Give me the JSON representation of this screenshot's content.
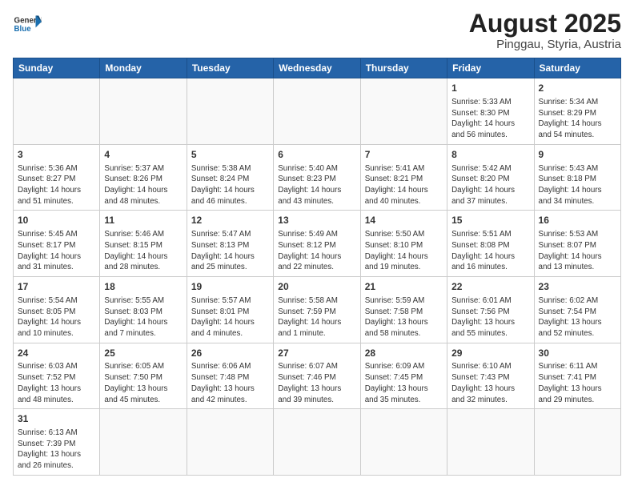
{
  "header": {
    "logo_general": "General",
    "logo_blue": "Blue",
    "title": "August 2025",
    "subtitle": "Pinggau, Styria, Austria"
  },
  "weekdays": [
    "Sunday",
    "Monday",
    "Tuesday",
    "Wednesday",
    "Thursday",
    "Friday",
    "Saturday"
  ],
  "weeks": [
    [
      {
        "day": "",
        "info": ""
      },
      {
        "day": "",
        "info": ""
      },
      {
        "day": "",
        "info": ""
      },
      {
        "day": "",
        "info": ""
      },
      {
        "day": "",
        "info": ""
      },
      {
        "day": "1",
        "info": "Sunrise: 5:33 AM\nSunset: 8:30 PM\nDaylight: 14 hours and 56 minutes."
      },
      {
        "day": "2",
        "info": "Sunrise: 5:34 AM\nSunset: 8:29 PM\nDaylight: 14 hours and 54 minutes."
      }
    ],
    [
      {
        "day": "3",
        "info": "Sunrise: 5:36 AM\nSunset: 8:27 PM\nDaylight: 14 hours and 51 minutes."
      },
      {
        "day": "4",
        "info": "Sunrise: 5:37 AM\nSunset: 8:26 PM\nDaylight: 14 hours and 48 minutes."
      },
      {
        "day": "5",
        "info": "Sunrise: 5:38 AM\nSunset: 8:24 PM\nDaylight: 14 hours and 46 minutes."
      },
      {
        "day": "6",
        "info": "Sunrise: 5:40 AM\nSunset: 8:23 PM\nDaylight: 14 hours and 43 minutes."
      },
      {
        "day": "7",
        "info": "Sunrise: 5:41 AM\nSunset: 8:21 PM\nDaylight: 14 hours and 40 minutes."
      },
      {
        "day": "8",
        "info": "Sunrise: 5:42 AM\nSunset: 8:20 PM\nDaylight: 14 hours and 37 minutes."
      },
      {
        "day": "9",
        "info": "Sunrise: 5:43 AM\nSunset: 8:18 PM\nDaylight: 14 hours and 34 minutes."
      }
    ],
    [
      {
        "day": "10",
        "info": "Sunrise: 5:45 AM\nSunset: 8:17 PM\nDaylight: 14 hours and 31 minutes."
      },
      {
        "day": "11",
        "info": "Sunrise: 5:46 AM\nSunset: 8:15 PM\nDaylight: 14 hours and 28 minutes."
      },
      {
        "day": "12",
        "info": "Sunrise: 5:47 AM\nSunset: 8:13 PM\nDaylight: 14 hours and 25 minutes."
      },
      {
        "day": "13",
        "info": "Sunrise: 5:49 AM\nSunset: 8:12 PM\nDaylight: 14 hours and 22 minutes."
      },
      {
        "day": "14",
        "info": "Sunrise: 5:50 AM\nSunset: 8:10 PM\nDaylight: 14 hours and 19 minutes."
      },
      {
        "day": "15",
        "info": "Sunrise: 5:51 AM\nSunset: 8:08 PM\nDaylight: 14 hours and 16 minutes."
      },
      {
        "day": "16",
        "info": "Sunrise: 5:53 AM\nSunset: 8:07 PM\nDaylight: 14 hours and 13 minutes."
      }
    ],
    [
      {
        "day": "17",
        "info": "Sunrise: 5:54 AM\nSunset: 8:05 PM\nDaylight: 14 hours and 10 minutes."
      },
      {
        "day": "18",
        "info": "Sunrise: 5:55 AM\nSunset: 8:03 PM\nDaylight: 14 hours and 7 minutes."
      },
      {
        "day": "19",
        "info": "Sunrise: 5:57 AM\nSunset: 8:01 PM\nDaylight: 14 hours and 4 minutes."
      },
      {
        "day": "20",
        "info": "Sunrise: 5:58 AM\nSunset: 7:59 PM\nDaylight: 14 hours and 1 minute."
      },
      {
        "day": "21",
        "info": "Sunrise: 5:59 AM\nSunset: 7:58 PM\nDaylight: 13 hours and 58 minutes."
      },
      {
        "day": "22",
        "info": "Sunrise: 6:01 AM\nSunset: 7:56 PM\nDaylight: 13 hours and 55 minutes."
      },
      {
        "day": "23",
        "info": "Sunrise: 6:02 AM\nSunset: 7:54 PM\nDaylight: 13 hours and 52 minutes."
      }
    ],
    [
      {
        "day": "24",
        "info": "Sunrise: 6:03 AM\nSunset: 7:52 PM\nDaylight: 13 hours and 48 minutes."
      },
      {
        "day": "25",
        "info": "Sunrise: 6:05 AM\nSunset: 7:50 PM\nDaylight: 13 hours and 45 minutes."
      },
      {
        "day": "26",
        "info": "Sunrise: 6:06 AM\nSunset: 7:48 PM\nDaylight: 13 hours and 42 minutes."
      },
      {
        "day": "27",
        "info": "Sunrise: 6:07 AM\nSunset: 7:46 PM\nDaylight: 13 hours and 39 minutes."
      },
      {
        "day": "28",
        "info": "Sunrise: 6:09 AM\nSunset: 7:45 PM\nDaylight: 13 hours and 35 minutes."
      },
      {
        "day": "29",
        "info": "Sunrise: 6:10 AM\nSunset: 7:43 PM\nDaylight: 13 hours and 32 minutes."
      },
      {
        "day": "30",
        "info": "Sunrise: 6:11 AM\nSunset: 7:41 PM\nDaylight: 13 hours and 29 minutes."
      }
    ],
    [
      {
        "day": "31",
        "info": "Sunrise: 6:13 AM\nSunset: 7:39 PM\nDaylight: 13 hours and 26 minutes."
      },
      {
        "day": "",
        "info": ""
      },
      {
        "day": "",
        "info": ""
      },
      {
        "day": "",
        "info": ""
      },
      {
        "day": "",
        "info": ""
      },
      {
        "day": "",
        "info": ""
      },
      {
        "day": "",
        "info": ""
      }
    ]
  ]
}
